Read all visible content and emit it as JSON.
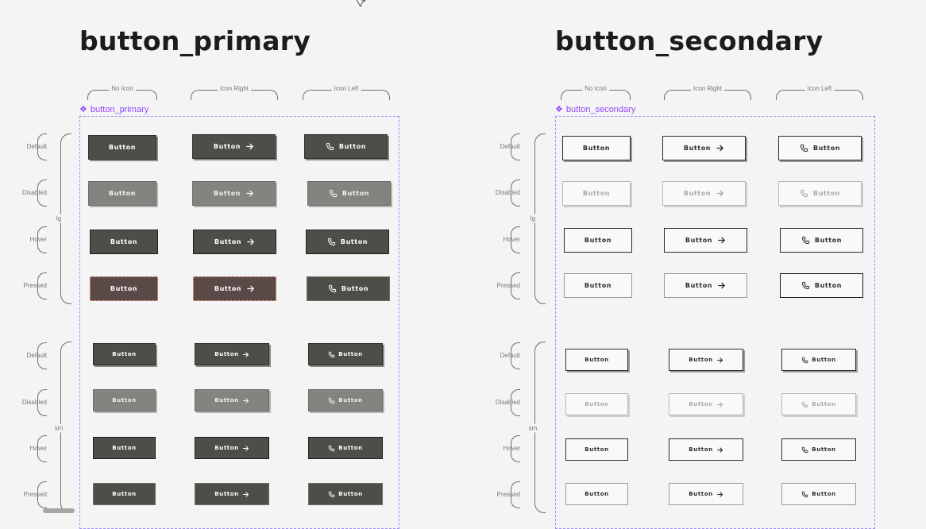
{
  "cursor": {
    "icon": "cursor-arrow-icon"
  },
  "sections": {
    "primary": {
      "title": "button_primary",
      "component_label": "button_primary",
      "accent_color": "#9747ff"
    },
    "secondary": {
      "title": "button_secondary",
      "component_label": "button_secondary",
      "accent_color": "#9747ff"
    }
  },
  "columns": [
    "No Icon",
    "Icon Right",
    "Icon Left"
  ],
  "states": [
    "Default",
    "Disabled",
    "Hover",
    "Pressed"
  ],
  "sizes": [
    "lg",
    "sm"
  ],
  "button_label": "Button",
  "icons": {
    "right": "arrow-right-icon",
    "left": "phone-icon"
  },
  "colors": {
    "primary_fill": "#4f4d48",
    "primary_disabled_fill": "#858380",
    "secondary_fill": "#faf9f7",
    "frame_border": "#9b8cff",
    "background": "#f4f4f4"
  }
}
